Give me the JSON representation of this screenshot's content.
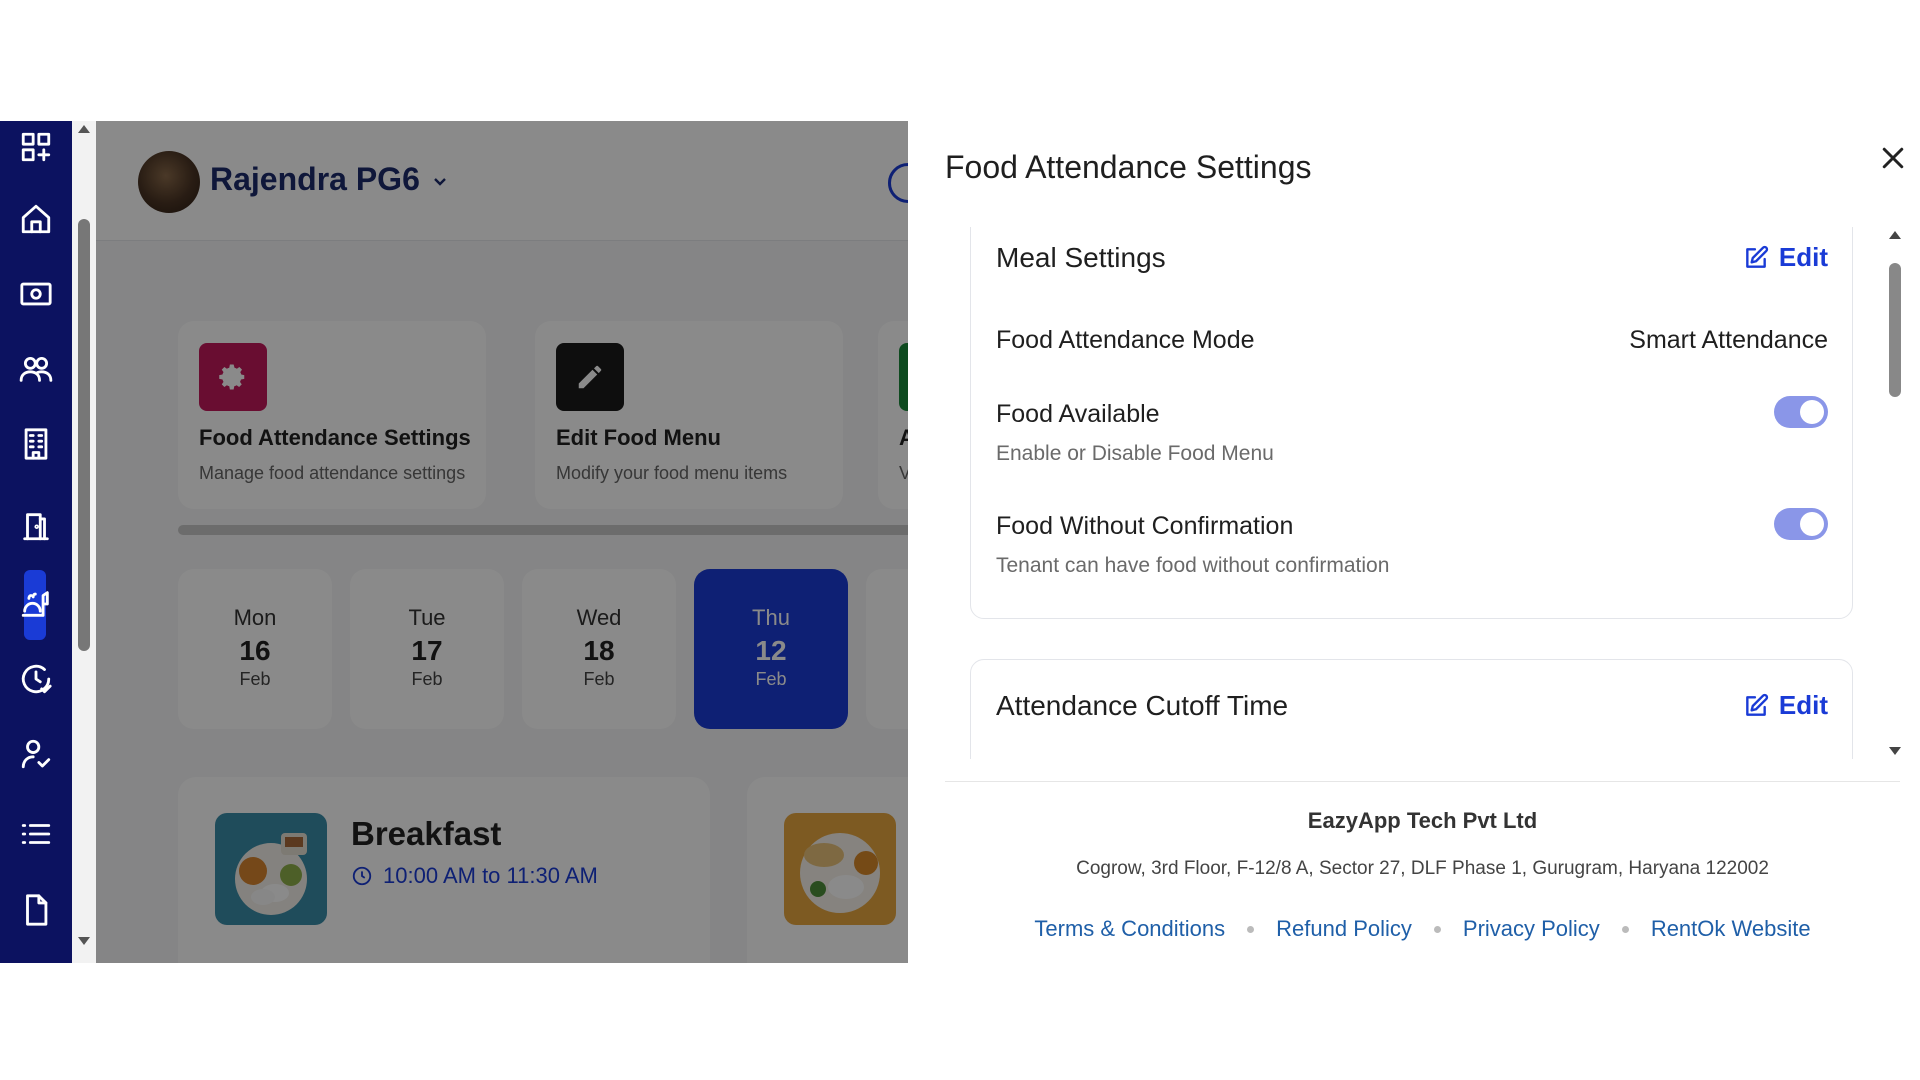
{
  "sidebar": {
    "items": [
      {
        "name": "apps-icon"
      },
      {
        "name": "home-icon"
      },
      {
        "name": "payments-icon"
      },
      {
        "name": "tenants-icon"
      },
      {
        "name": "building-icon"
      },
      {
        "name": "rooms-icon"
      },
      {
        "name": "food-icon"
      },
      {
        "name": "attendance-icon"
      },
      {
        "name": "user-check-icon"
      },
      {
        "name": "list-icon"
      },
      {
        "name": "document-icon"
      }
    ],
    "active": "food-icon"
  },
  "header": {
    "org_name": "Rajendra PG6"
  },
  "action_cards": [
    {
      "title": "Food Attendance Settings",
      "subtitle": "Manage food attendance settings",
      "icon": "gear-icon",
      "color": "#c2185b"
    },
    {
      "title": "Edit Food Menu",
      "subtitle": "Modify your food menu items",
      "icon": "pencil-icon",
      "color": "#1a1a1a"
    },
    {
      "title": "Att",
      "subtitle": "Vie",
      "icon": "chart-icon",
      "color": "#1b8a3a"
    }
  ],
  "dates": [
    {
      "dow": "Mon",
      "day": "16",
      "mon": "Feb"
    },
    {
      "dow": "Tue",
      "day": "17",
      "mon": "Feb"
    },
    {
      "dow": "Wed",
      "day": "18",
      "mon": "Feb"
    },
    {
      "dow": "Thu",
      "day": "12",
      "mon": "Feb",
      "active": true
    }
  ],
  "meals": [
    {
      "title": "Breakfast",
      "time": "10:00 AM to 11:30 AM"
    }
  ],
  "drawer": {
    "title": "Food Attendance Settings",
    "meal_settings": {
      "title": "Meal Settings",
      "edit_label": "Edit",
      "mode_label": "Food Attendance Mode",
      "mode_value": "Smart Attendance",
      "food_available_label": "Food Available",
      "food_available_sub": "Enable or Disable Food Menu",
      "food_available_on": true,
      "without_conf_label": "Food Without Confirmation",
      "without_conf_sub": "Tenant can have food without confirmation",
      "without_conf_on": true
    },
    "cutoff": {
      "title": "Attendance Cutoff Time",
      "edit_label": "Edit"
    },
    "footer": {
      "company": "EazyApp Tech Pvt Ltd",
      "address": "Cogrow, 3rd Floor, F-12/8 A, Sector 27, DLF Phase 1, Gurugram, Haryana 122002",
      "links": [
        "Terms & Conditions",
        "Refund Policy",
        "Privacy Policy",
        "RentOk Website"
      ]
    }
  },
  "colors": {
    "sidebar_bg": "#0c1260",
    "accent": "#1a3bd6",
    "toggle_on": "#8a96e8",
    "link": "#1f5fa8"
  }
}
